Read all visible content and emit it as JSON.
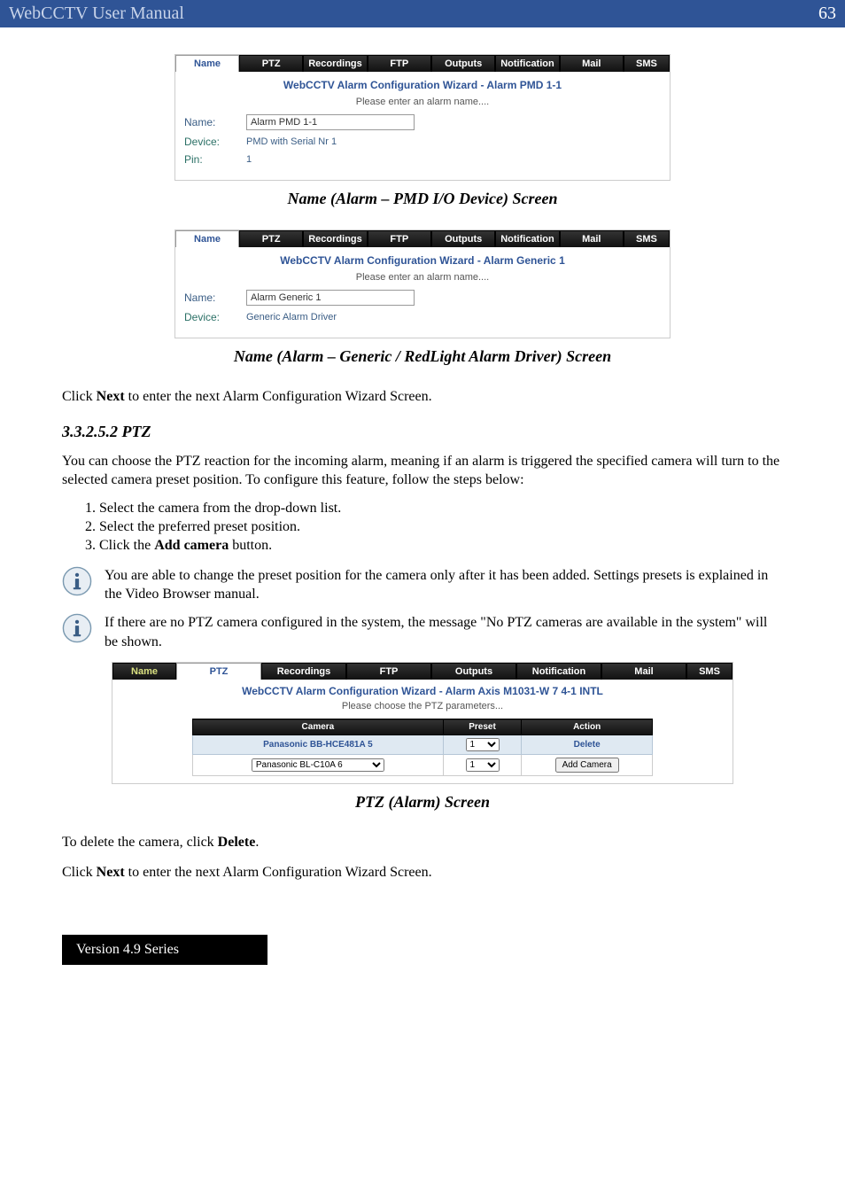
{
  "header": {
    "title": "WebCCTV User Manual",
    "page_num": "63"
  },
  "tab_labels": [
    "Name",
    "PTZ",
    "Recordings",
    "FTP",
    "Outputs",
    "Notification",
    "Mail",
    "SMS"
  ],
  "shot1": {
    "wizard_title": "WebCCTV Alarm Configuration Wizard - Alarm PMD 1-1",
    "instruction": "Please enter an alarm name....",
    "name_label": "Name:",
    "name_value": "Alarm PMD 1-1",
    "device_label": "Device:",
    "device_value": "PMD with Serial Nr 1",
    "pin_label": "Pin:",
    "pin_value": "1"
  },
  "caption1": "Name (Alarm – PMD I/O Device) Screen",
  "shot2": {
    "wizard_title": "WebCCTV Alarm Configuration Wizard - Alarm Generic 1",
    "instruction": "Please enter an alarm name....",
    "name_label": "Name:",
    "name_value": "Alarm Generic 1",
    "device_label": "Device:",
    "device_value": "Generic Alarm Driver"
  },
  "caption2": "Name (Alarm – Generic / RedLight Alarm Driver) Screen",
  "click_next": "Click Next to enter the next Alarm Configuration Wizard Screen.",
  "section_num": "3.3.2.5.2",
  "section_title": "PTZ",
  "ptz_intro": "You can choose the PTZ reaction for the incoming alarm, meaning if an alarm is triggered the specified camera will turn to the selected camera preset position. To configure this feature, follow the steps below:",
  "steps": [
    "Select the camera from the drop-down list.",
    "Select the preferred preset position.",
    "Click the Add camera button."
  ],
  "note1": "You are able to change the preset position for the camera only after it has been added. Settings presets is explained in the Video Browser manual.",
  "note2": "If there are no PTZ camera configured in the system, the message \"No PTZ cameras are available in the system\" will be shown.",
  "shotptz": {
    "wizard_title": "WebCCTV Alarm Configuration Wizard - Alarm Axis M1031-W 7 4-1 INTL",
    "instruction": "Please choose the PTZ parameters...",
    "cols": [
      "Camera",
      "Preset",
      "Action"
    ],
    "row1": {
      "camera": "Panasonic BB-HCE481A 5",
      "preset": "1",
      "action": "Delete"
    },
    "row2": {
      "camera": "Panasonic BL-C10A 6",
      "preset": "1",
      "action": "Add Camera"
    }
  },
  "caption3": "PTZ (Alarm) Screen",
  "delete_text": "To delete the camera, click Delete.",
  "click_next2": "Click Next to enter the next Alarm Configuration Wizard Screen.",
  "footer": "Version 4.9 Series"
}
